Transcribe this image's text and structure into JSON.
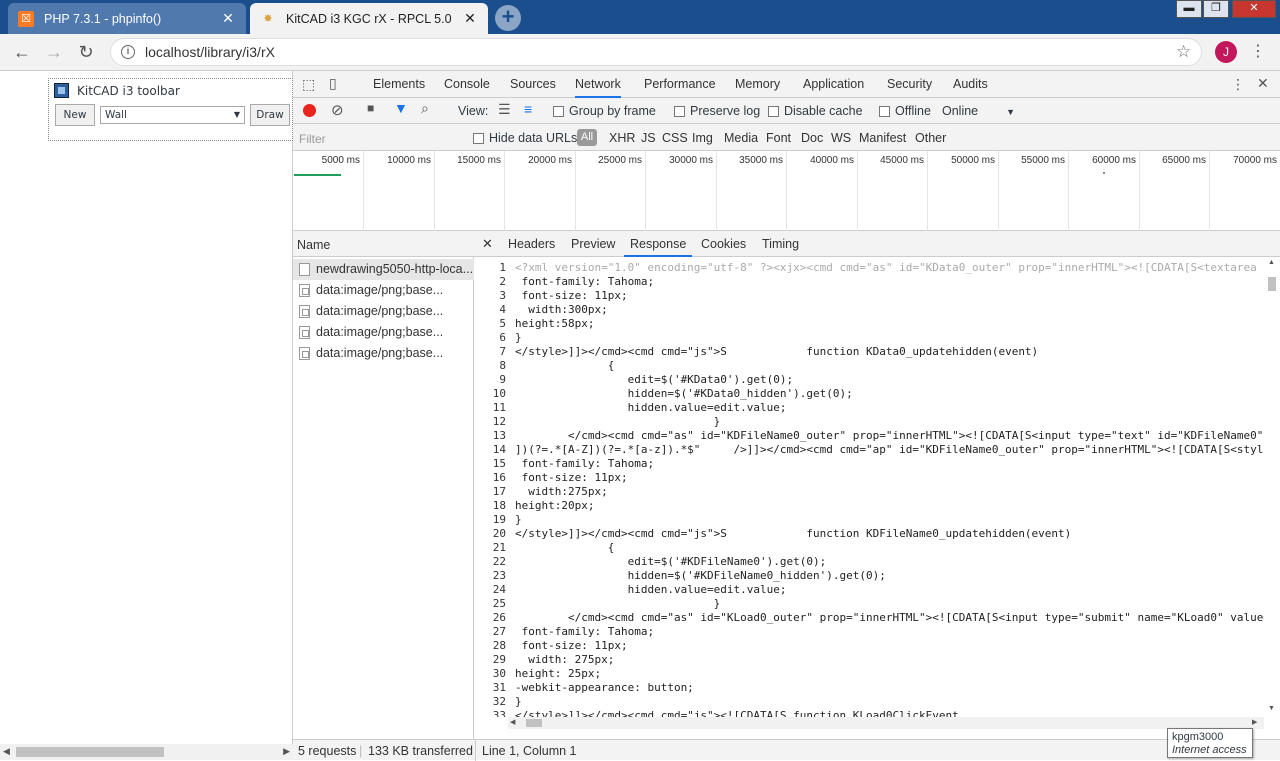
{
  "browser": {
    "tabs": [
      {
        "title": "PHP 7.3.1 - phpinfo()",
        "favicon": "xampp-icon"
      },
      {
        "title": "KitCAD i3 KGC rX - RPCL 5.0",
        "favicon": "kitcad-icon"
      }
    ],
    "new_tab_glyph": "+",
    "close_glyph": "✕",
    "url": "localhost/library/i3/rX",
    "profile_initial": "J",
    "window_controls": [
      "▬",
      "❐",
      "✕"
    ]
  },
  "page": {
    "toolbar_title": "KitCAD i3 toolbar",
    "new_label": "New",
    "select_value": "Wall",
    "draw_label": "Draw"
  },
  "devtools": {
    "tabs": [
      "Elements",
      "Console",
      "Sources",
      "Network",
      "Performance",
      "Memory",
      "Application",
      "Security",
      "Audits"
    ],
    "active_tab": "Network",
    "toolbar": {
      "view_label": "View:",
      "group_by_frame": "Group by frame",
      "preserve_log": "Preserve log",
      "disable_cache": "Disable cache",
      "offline": "Offline",
      "throttle": "Online"
    },
    "filter": {
      "placeholder": "Filter",
      "hide_data_urls": "Hide data URLs",
      "types": [
        "All",
        "XHR",
        "JS",
        "CSS",
        "Img",
        "Media",
        "Font",
        "Doc",
        "WS",
        "Manifest",
        "Other"
      ]
    },
    "timeline_ticks": [
      "5000 ms",
      "10000 ms",
      "15000 ms",
      "20000 ms",
      "25000 ms",
      "30000 ms",
      "35000 ms",
      "40000 ms",
      "45000 ms",
      "50000 ms",
      "55000 ms",
      "60000 ms",
      "65000 ms",
      "70000 ms"
    ],
    "name_header": "Name",
    "requests": [
      {
        "name": "newdrawing5050-http-loca...",
        "type": "doc"
      },
      {
        "name": "data:image/png;base...",
        "type": "img"
      },
      {
        "name": "data:image/png;base...",
        "type": "img"
      },
      {
        "name": "data:image/png;base...",
        "type": "img"
      },
      {
        "name": "data:image/png;base...",
        "type": "img"
      }
    ],
    "detail_tabs": [
      "Headers",
      "Preview",
      "Response",
      "Cookies",
      "Timing"
    ],
    "active_detail_tab": "Response",
    "response_lines": [
      "<?xml version=\"1.0\" encoding=\"utf-8\" ?><xjx><cmd cmd=\"as\" id=\"KData0_outer\" prop=\"innerHTML\"><![CDATA[S<textarea",
      " font-family: Tahoma;",
      " font-size: 11px;",
      "  width:300px;",
      "height:58px;",
      "}",
      "</style>]]></cmd><cmd cmd=\"js\">S            function KData0_updatehidden(event)",
      "              {",
      "                 edit=$('#KData0').get(0);",
      "                 hidden=$('#KData0_hidden').get(0);",
      "                 hidden.value=edit.value;",
      "                              }",
      "        </cmd><cmd cmd=\"as\" id=\"KDFileName0_outer\" prop=\"innerHTML\"><![CDATA[S<input type=\"text\" id=\"KDFileName0\"",
      "])(?=.*[A-Z])(?=.*[a-z]).*$\"     />]]></cmd><cmd cmd=\"ap\" id=\"KDFileName0_outer\" prop=\"innerHTML\"><![CDATA[S<style",
      " font-family: Tahoma;",
      " font-size: 11px;",
      "  width:275px;",
      "height:20px;",
      "}",
      "</style>]]></cmd><cmd cmd=\"js\">S            function KDFileName0_updatehidden(event)",
      "              {",
      "                 edit=$('#KDFileName0').get(0);",
      "                 hidden=$('#KDFileName0_hidden').get(0);",
      "                 hidden.value=edit.value;",
      "                              }",
      "        </cmd><cmd cmd=\"as\" id=\"KLoad0_outer\" prop=\"innerHTML\"><![CDATA[S<input type=\"submit\" name=\"KLoad0\" value=",
      " font-family: Tahoma;",
      " font-size: 11px;",
      "  width: 275px;",
      "height: 25px;",
      "-webkit-appearance: button;",
      "}",
      "</style>]]></cmd><cmd cmd=\"js\"><![CDATA[S function KLoad0ClickEvent"
    ],
    "status": {
      "requests": "5 requests",
      "transferred": "133 KB transferred",
      "cursor": "Line 1, Column 1"
    }
  },
  "tooltip": {
    "title": "kpgm3000",
    "subtitle": "Internet access"
  }
}
